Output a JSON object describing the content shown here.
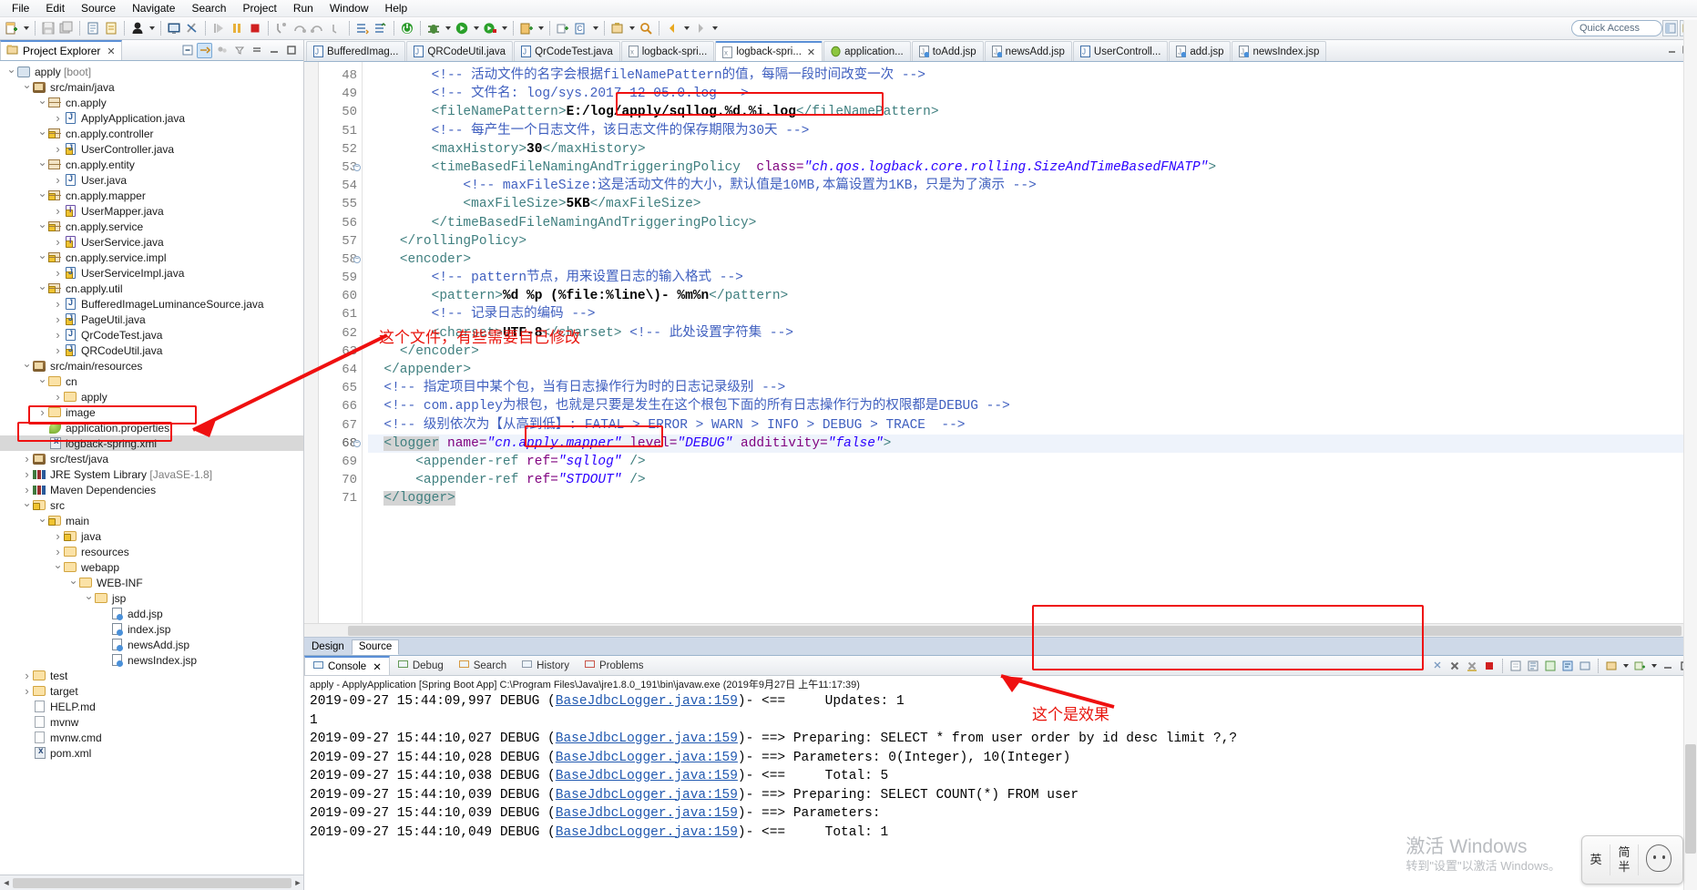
{
  "menubar": [
    "File",
    "Edit",
    "Source",
    "Navigate",
    "Search",
    "Project",
    "Run",
    "Window",
    "Help"
  ],
  "toolbar": {
    "quick_access_placeholder": "Quick Access",
    "icons": [
      "new-wizard-icon",
      "save-icon",
      "save-all-icon",
      "print-icon",
      "toggle-mark-occurrences-icon",
      "new-java-class-icon",
      "open-type-icon",
      "skip-breakpoints-icon",
      "run-last-tool-icon",
      "resume-icon",
      "suspend-icon",
      "terminate-icon",
      "step-into-icon",
      "step-over-icon",
      "step-return-icon",
      "drop-to-frame-icon",
      "next-annotation-icon",
      "previous-annotation-icon",
      "power-icon",
      "debug-icon",
      "run-icon",
      "run-external-tool-icon",
      "coverage-icon",
      "search-icon",
      "open-task-icon",
      "back-icon",
      "forward-icon"
    ]
  },
  "project_explorer": {
    "title": "Project Explorer",
    "tree": [
      {
        "indent": 0,
        "twisty": "open",
        "icon": "project",
        "label": "apply",
        "suffix": " [boot]"
      },
      {
        "indent": 1,
        "twisty": "open",
        "icon": "srcfolder",
        "label": "src/main/java"
      },
      {
        "indent": 2,
        "twisty": "open",
        "icon": "pkg",
        "label": "cn.apply"
      },
      {
        "indent": 3,
        "twisty": "closed",
        "icon": "java",
        "label": "ApplyApplication.java"
      },
      {
        "indent": 2,
        "twisty": "open",
        "icon": "pkg",
        "label": "cn.apply.controller",
        "warn": true
      },
      {
        "indent": 3,
        "twisty": "closed",
        "icon": "java",
        "label": "UserController.java",
        "warn": true
      },
      {
        "indent": 2,
        "twisty": "open",
        "icon": "pkg",
        "label": "cn.apply.entity"
      },
      {
        "indent": 3,
        "twisty": "closed",
        "icon": "java",
        "label": "User.java"
      },
      {
        "indent": 2,
        "twisty": "open",
        "icon": "pkg",
        "label": "cn.apply.mapper",
        "warn": true
      },
      {
        "indent": 3,
        "twisty": "closed",
        "icon": "interface",
        "label": "UserMapper.java",
        "warn": true
      },
      {
        "indent": 2,
        "twisty": "open",
        "icon": "pkg",
        "label": "cn.apply.service",
        "warn": true
      },
      {
        "indent": 3,
        "twisty": "closed",
        "icon": "interface",
        "label": "UserService.java",
        "warn": true
      },
      {
        "indent": 2,
        "twisty": "open",
        "icon": "pkg",
        "label": "cn.apply.service.impl",
        "warn": true
      },
      {
        "indent": 3,
        "twisty": "closed",
        "icon": "java",
        "label": "UserServiceImpl.java",
        "warn": true
      },
      {
        "indent": 2,
        "twisty": "open",
        "icon": "pkg",
        "label": "cn.apply.util",
        "warn": true
      },
      {
        "indent": 3,
        "twisty": "closed",
        "icon": "java",
        "label": "BufferedImageLuminanceSource.java"
      },
      {
        "indent": 3,
        "twisty": "closed",
        "icon": "java",
        "label": "PageUtil.java",
        "warn": true
      },
      {
        "indent": 3,
        "twisty": "closed",
        "icon": "java",
        "label": "QrCodeTest.java"
      },
      {
        "indent": 3,
        "twisty": "closed",
        "icon": "java",
        "label": "QRCodeUtil.java",
        "warn": true
      },
      {
        "indent": 1,
        "twisty": "open",
        "icon": "srcfolder",
        "label": "src/main/resources"
      },
      {
        "indent": 2,
        "twisty": "open",
        "icon": "folder",
        "label": "cn"
      },
      {
        "indent": 3,
        "twisty": "closed",
        "icon": "folder",
        "label": "apply"
      },
      {
        "indent": 2,
        "twisty": "closed",
        "icon": "folder",
        "label": "image"
      },
      {
        "indent": 2,
        "twisty": "none",
        "icon": "props",
        "label": "application.properties"
      },
      {
        "indent": 2,
        "twisty": "none",
        "icon": "xml",
        "label": "logback-spring.xml",
        "selected": true
      },
      {
        "indent": 1,
        "twisty": "closed",
        "icon": "srcfolder",
        "label": "src/test/java"
      },
      {
        "indent": 1,
        "twisty": "closed",
        "icon": "lib",
        "label": "JRE System Library",
        "suffix": " [JavaSE-1.8]"
      },
      {
        "indent": 1,
        "twisty": "closed",
        "icon": "lib",
        "label": "Maven Dependencies"
      },
      {
        "indent": 1,
        "twisty": "open",
        "icon": "folder",
        "label": "src",
        "warn": true
      },
      {
        "indent": 2,
        "twisty": "open",
        "icon": "folder",
        "label": "main",
        "warn": true
      },
      {
        "indent": 3,
        "twisty": "closed",
        "icon": "folder",
        "label": "java",
        "warn": true
      },
      {
        "indent": 3,
        "twisty": "closed",
        "icon": "folder",
        "label": "resources"
      },
      {
        "indent": 3,
        "twisty": "open",
        "icon": "folder",
        "label": "webapp"
      },
      {
        "indent": 4,
        "twisty": "open",
        "icon": "folder",
        "label": "WEB-INF"
      },
      {
        "indent": 5,
        "twisty": "open",
        "icon": "folder",
        "label": "jsp"
      },
      {
        "indent": 6,
        "twisty": "none",
        "icon": "jsp",
        "label": "add.jsp"
      },
      {
        "indent": 6,
        "twisty": "none",
        "icon": "jsp",
        "label": "index.jsp"
      },
      {
        "indent": 6,
        "twisty": "none",
        "icon": "jsp",
        "label": "newsAdd.jsp"
      },
      {
        "indent": 6,
        "twisty": "none",
        "icon": "jsp",
        "label": "newsIndex.jsp"
      },
      {
        "indent": 1,
        "twisty": "closed",
        "icon": "folder",
        "label": "test"
      },
      {
        "indent": 1,
        "twisty": "closed",
        "icon": "folder",
        "label": "target"
      },
      {
        "indent": 1,
        "twisty": "none",
        "icon": "md",
        "label": "HELP.md"
      },
      {
        "indent": 1,
        "twisty": "none",
        "icon": "file",
        "label": "mvnw"
      },
      {
        "indent": 1,
        "twisty": "none",
        "icon": "file",
        "label": "mvnw.cmd"
      },
      {
        "indent": 1,
        "twisty": "none",
        "icon": "xml",
        "label": "pom.xml"
      }
    ]
  },
  "editor_tabs": [
    {
      "label": "BufferedImag...",
      "icon": "java-file-icon",
      "active": false,
      "dirty": false
    },
    {
      "label": "QRCodeUtil.java",
      "icon": "java-file-icon",
      "active": false,
      "dirty": false
    },
    {
      "label": "QrCodeTest.java",
      "icon": "java-file-icon",
      "active": false,
      "dirty": false
    },
    {
      "label": "logback-spri...",
      "icon": "xml-file-icon",
      "active": false,
      "dirty": false
    },
    {
      "label": "logback-spri...",
      "icon": "xml-file-icon",
      "active": true,
      "dirty": false
    },
    {
      "label": "application...",
      "icon": "properties-file-icon",
      "active": false,
      "dirty": false
    },
    {
      "label": "toAdd.jsp",
      "icon": "jsp-file-icon",
      "active": false,
      "dirty": false
    },
    {
      "label": "newsAdd.jsp",
      "icon": "jsp-file-icon",
      "active": false,
      "dirty": false
    },
    {
      "label": "UserControll...",
      "icon": "java-file-icon",
      "active": false,
      "dirty": false
    },
    {
      "label": "add.jsp",
      "icon": "jsp-file-icon",
      "active": false,
      "dirty": false
    },
    {
      "label": "newsIndex.jsp",
      "icon": "jsp-file-icon",
      "active": false,
      "dirty": false
    }
  ],
  "editor": {
    "first_line": 48,
    "current_line": 68,
    "fold_lines": [
      53,
      58,
      68
    ],
    "lines": [
      {
        "n": 48,
        "html": "        <span class='cmt'>&lt;!-- 活动文件的名字会根据fileNamePattern的值，每隔一段时间改变一次 --&gt;</span>"
      },
      {
        "n": 49,
        "html": "        <span class='cmt'>&lt;!-- 文件名: log/sys.2017-12-05.0.log --&gt;</span>"
      },
      {
        "n": 50,
        "html": "        <span class='tagn'>&lt;fileNamePattern&gt;</span><span class='txtv'>E:/log/apply/sqllog.%d.%i.log</span><span class='tagn'>&lt;/fileNamePattern&gt;</span>"
      },
      {
        "n": 51,
        "html": "        <span class='cmt'>&lt;!-- 每产生一个日志文件，该日志文件的保存期限为30天 --&gt;</span>"
      },
      {
        "n": 52,
        "html": "        <span class='tagn'>&lt;maxHistory&gt;</span><span class='txtv'>30</span><span class='tagn'>&lt;/maxHistory&gt;</span>"
      },
      {
        "n": 53,
        "html": "        <span class='tagn'>&lt;timeBasedFileNamingAndTriggeringPolicy</span>  <span class='attr'>class=</span><span class='aval'>\"ch.qos.logback.core.rolling.SizeAndTimeBasedFNATP\"</span><span class='tagn'>&gt;</span>"
      },
      {
        "n": 54,
        "html": "            <span class='cmt'>&lt;!-- maxFileSize:这是活动文件的大小，默认值是10MB,本篇设置为1KB，只是为了演示 --&gt;</span>"
      },
      {
        "n": 55,
        "html": "            <span class='tagn'>&lt;maxFileSize&gt;</span><span class='txtv'>5KB</span><span class='tagn'>&lt;/maxFileSize&gt;</span>"
      },
      {
        "n": 56,
        "html": "        <span class='tagn'>&lt;/timeBasedFileNamingAndTriggeringPolicy&gt;</span>"
      },
      {
        "n": 57,
        "html": "    <span class='tagn'>&lt;/rollingPolicy&gt;</span>"
      },
      {
        "n": 58,
        "html": "    <span class='tagn'>&lt;encoder&gt;</span>"
      },
      {
        "n": 59,
        "html": "        <span class='cmt'>&lt;!-- pattern节点，用来设置日志的输入格式 --&gt;</span>"
      },
      {
        "n": 60,
        "html": "        <span class='tagn'>&lt;pattern&gt;</span><span class='txtv'>%d %p (%file:%line\\)- %m%n</span><span class='tagn'>&lt;/pattern&gt;</span>"
      },
      {
        "n": 61,
        "html": "        <span class='cmt'>&lt;!-- 记录日志的编码 --&gt;</span>"
      },
      {
        "n": 62,
        "html": "        <span class='tagn'>&lt;charset&gt;</span><span class='txtv'>UTF-8</span><span class='tagn'>&lt;/charset&gt;</span> <span class='cmt'>&lt;!-- 此处设置字符集 --&gt;</span>"
      },
      {
        "n": 63,
        "html": "    <span class='tagn'>&lt;/encoder&gt;</span>"
      },
      {
        "n": 64,
        "html": "  <span class='tagn'>&lt;/appender&gt;</span>"
      },
      {
        "n": 65,
        "html": "  <span class='cmt'>&lt;!-- 指定项目中某个包，当有日志操作行为时的日志记录级别 --&gt;</span>"
      },
      {
        "n": 66,
        "html": "  <span class='cmt'>&lt;!-- com.appley为根包，也就是只要是发生在这个根包下面的所有日志操作行为的权限都是DEBUG --&gt;</span>"
      },
      {
        "n": 67,
        "html": "  <span class='cmt'>&lt;!-- 级别依次为【从高到低】: FATAL &gt; ERROR &gt; WARN &gt; INFO &gt; DEBUG &gt; TRACE  --&gt;</span>"
      },
      {
        "n": 68,
        "html": "  <span class='tagn sel'>&lt;logger</span> <span class='attr'>name=</span><span class='aval'>\"cn.apply.mapper\"</span> <span class='attr'>level=</span><span class='aval'>\"DEBUG\"</span> <span class='attr'>additivity=</span><span class='aval'>\"false\"</span><span class='tagn'>&gt;</span>"
      },
      {
        "n": 69,
        "html": "      <span class='tagn'>&lt;appender-ref</span> <span class='attr'>ref=</span><span class='aval'>\"sqllog\"</span> <span class='tagn'>/&gt;</span>"
      },
      {
        "n": 70,
        "html": "      <span class='tagn'>&lt;appender-ref</span> <span class='attr'>ref=</span><span class='aval'>\"STDOUT\"</span> <span class='tagn'>/&gt;</span>"
      },
      {
        "n": 71,
        "html": "  <span class='tagn sel'>&lt;/logger&gt;</span>"
      }
    ],
    "design_source_tabs": [
      "Design",
      "Source"
    ],
    "active_ds_tab": "Source"
  },
  "console": {
    "tabs": [
      {
        "label": "Console",
        "icon": "console-icon",
        "active": true,
        "closable": true
      },
      {
        "label": "Debug",
        "icon": "debug-icon",
        "active": false,
        "closable": false
      },
      {
        "label": "Search",
        "icon": "search-icon",
        "active": false,
        "closable": false
      },
      {
        "label": "History",
        "icon": "history-icon",
        "active": false,
        "closable": false
      },
      {
        "label": "Problems",
        "icon": "problems-icon",
        "active": false,
        "closable": false
      }
    ],
    "launch_header": "apply - ApplyApplication [Spring Boot App] C:\\Program Files\\Java\\jre1.8.0_191\\bin\\javaw.exe (2019年9月27日 上午11:17:39)",
    "lines": [
      {
        "ts": "2019-09-27 15:44:09,997",
        "level": "DEBUG",
        "link": "BaseJdbcLogger.java:159",
        "arrow": "<==",
        "msg": "    Updates: 1"
      },
      {
        "ts": "",
        "level": "",
        "link": "",
        "arrow": "",
        "msg": "1",
        "plain": true
      },
      {
        "ts": "2019-09-27 15:44:10,027",
        "level": "DEBUG",
        "link": "BaseJdbcLogger.java:159",
        "arrow": "==>",
        "msg": "Preparing: SELECT * from user order by id desc limit ?,?"
      },
      {
        "ts": "2019-09-27 15:44:10,028",
        "level": "DEBUG",
        "link": "BaseJdbcLogger.java:159",
        "arrow": "==>",
        "msg": "Parameters: 0(Integer), 10(Integer)"
      },
      {
        "ts": "2019-09-27 15:44:10,038",
        "level": "DEBUG",
        "link": "BaseJdbcLogger.java:159",
        "arrow": "<==",
        "msg": "    Total: 5"
      },
      {
        "ts": "2019-09-27 15:44:10,039",
        "level": "DEBUG",
        "link": "BaseJdbcLogger.java:159",
        "arrow": "==>",
        "msg": "Preparing: SELECT COUNT(*) FROM user"
      },
      {
        "ts": "2019-09-27 15:44:10,039",
        "level": "DEBUG",
        "link": "BaseJdbcLogger.java:159",
        "arrow": "==>",
        "msg": "Parameters: "
      },
      {
        "ts": "2019-09-27 15:44:10,049",
        "level": "DEBUG",
        "link": "BaseJdbcLogger.java:159",
        "arrow": "<==",
        "msg": "    Total: 1"
      }
    ]
  },
  "annotations": {
    "note_edit_file": "这个文件，有些需要自己修改",
    "note_effect": "这个是效果",
    "accent_color": "#ef1010"
  },
  "ime": {
    "mode_label": "英",
    "shape_label_top": "简",
    "shape_label_bottom": "半"
  },
  "watermark": {
    "line1": "激活 Windows",
    "line2": "转到\"设置\"以激活 Windows。"
  }
}
